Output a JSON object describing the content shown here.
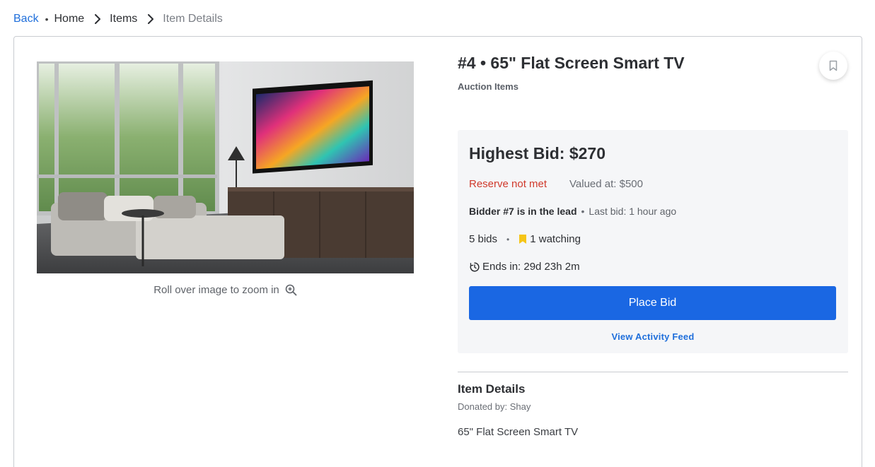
{
  "breadcrumb": {
    "back": "Back",
    "separator": "•",
    "home": "Home",
    "items": "Items",
    "current": "Item Details"
  },
  "item": {
    "title": "#4 • 65\" Flat Screen Smart TV",
    "category": "Auction Items",
    "zoom_hint": "Roll over image to zoom in"
  },
  "bid": {
    "highest": "Highest Bid: $270",
    "reserve_status": "Reserve not met",
    "valued": "Valued at: $500",
    "lead": "Bidder #7 is in the lead",
    "separator": "•",
    "last_bid": "Last bid: 1 hour ago",
    "bids_count": "5 bids",
    "watching": "1 watching",
    "ends": "Ends in: 29d 23h 2m",
    "place_bid_label": "Place Bid",
    "activity_label": "View Activity Feed"
  },
  "details": {
    "title": "Item Details",
    "donated_by": "Donated by: Shay",
    "description": "65\" Flat Screen Smart TV"
  },
  "colors": {
    "link": "#1f6fdb",
    "button": "#1a67e3",
    "reserve": "#d0392b",
    "watch_icon": "#f5c518",
    "panel": "#f5f6f8"
  },
  "icons": {
    "chevron": "chevron-right-icon",
    "zoom": "zoom-in-icon",
    "bookmark": "bookmark-icon",
    "watch": "bookmark-filled-icon",
    "timer": "timer-icon"
  }
}
